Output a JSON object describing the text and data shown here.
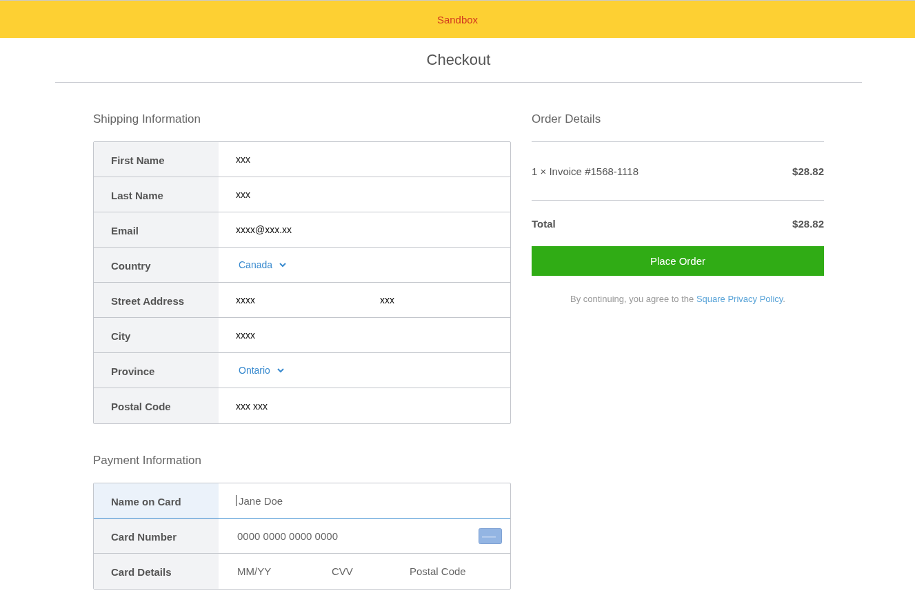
{
  "banner": {
    "label": "Sandbox"
  },
  "title": "Checkout",
  "shipping": {
    "heading": "Shipping Information",
    "rows": [
      {
        "kind": "text",
        "label": "First Name",
        "values": [
          "xxx"
        ]
      },
      {
        "kind": "text",
        "label": "Last Name",
        "values": [
          "xxx"
        ]
      },
      {
        "kind": "text",
        "label": "Email",
        "values": [
          "xxxx@xxx.xx"
        ]
      },
      {
        "kind": "select",
        "label": "Country",
        "values": [
          "Canada"
        ]
      },
      {
        "kind": "text",
        "label": "Street Address",
        "values": [
          "xxxx",
          "xxx"
        ]
      },
      {
        "kind": "text",
        "label": "City",
        "values": [
          "xxxx"
        ]
      },
      {
        "kind": "select",
        "label": "Province",
        "values": [
          "Ontario"
        ]
      },
      {
        "kind": "text",
        "label": "Postal Code",
        "values": [
          "xxx xxx"
        ]
      }
    ]
  },
  "payment": {
    "heading": "Payment Information",
    "rows": [
      {
        "kind": "text",
        "label": "Name on Card",
        "placeholders": [
          "Jane Doe"
        ],
        "focused": true
      },
      {
        "kind": "card",
        "label": "Card Number",
        "placeholders": [
          "0000 0000 0000 0000"
        ],
        "focused": false
      },
      {
        "kind": "text",
        "label": "Card Details",
        "placeholders": [
          "MM/YY",
          "CVV",
          "Postal Code"
        ],
        "focused": false
      }
    ]
  },
  "order": {
    "heading": "Order Details",
    "items": [
      {
        "name": "1 × Invoice #1568-1118",
        "price": "$28.82"
      }
    ],
    "total": {
      "label": "Total",
      "price": "$28.82"
    },
    "button": "Place Order",
    "policy": {
      "prefix": "By continuing, you agree to the ",
      "link": "Square Privacy Policy",
      "suffix": "."
    }
  }
}
